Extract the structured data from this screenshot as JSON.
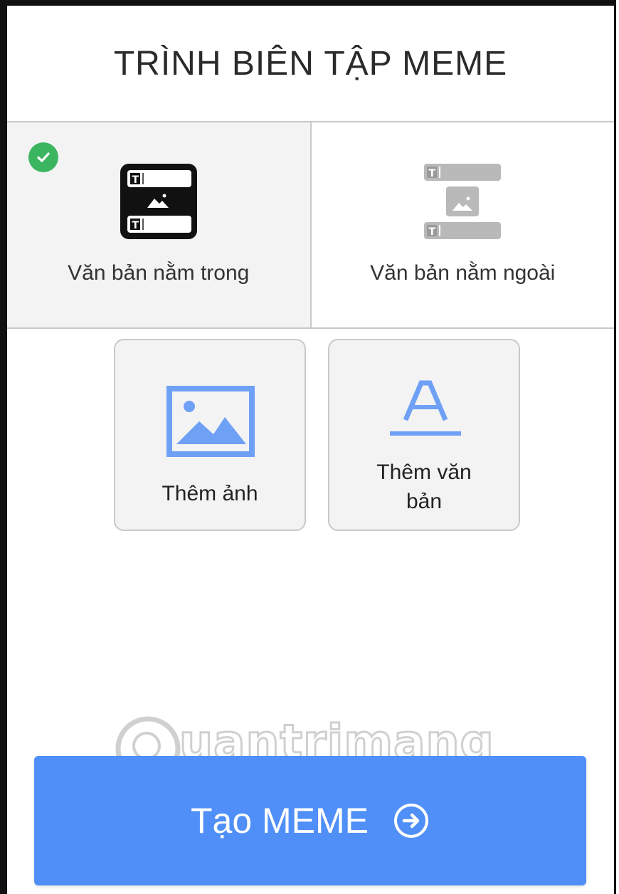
{
  "header": {
    "title": "TRÌNH BIÊN TẬP MEME"
  },
  "layout_options": [
    {
      "label": "Văn bản nằm trong",
      "selected": true,
      "icon": "text-inside-layout-icon"
    },
    {
      "label": "Văn bản nằm ngoài",
      "selected": false,
      "icon": "text-outside-layout-icon"
    }
  ],
  "tools": {
    "add_image": {
      "label": "Thêm ảnh",
      "icon": "image-icon"
    },
    "add_text": {
      "label": "Thêm văn bản",
      "icon": "text-a-icon"
    }
  },
  "watermark": {
    "text": "uantrimang"
  },
  "create_button": {
    "label": "Tạo MEME",
    "icon": "arrow-right-circle-icon"
  },
  "colors": {
    "accent": "#4f8ff7",
    "check": "#3cb560",
    "tool_icon": "#6ea0f6"
  }
}
